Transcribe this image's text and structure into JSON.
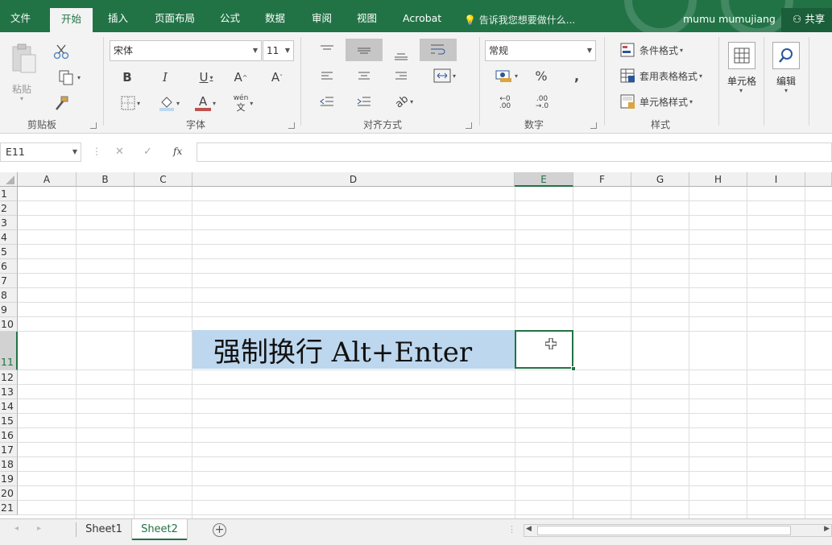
{
  "tabs": [
    "文件",
    "开始",
    "插入",
    "页面布局",
    "公式",
    "数据",
    "审阅",
    "视图",
    "Acrobat"
  ],
  "active_tab": "开始",
  "tell_me": "告诉我您想要做什么...",
  "user_name": "mumu mumujiang",
  "share": "共享",
  "clipboard": {
    "paste": "粘贴",
    "label": "剪贴板"
  },
  "font": {
    "name": "宋体",
    "size": "11",
    "label": "字体",
    "pinyin_top": "wén",
    "pinyin_bottom": "文"
  },
  "alignment": {
    "label": "对齐方式"
  },
  "number": {
    "format": "常规",
    "label": "数字",
    "percent": "%",
    "comma": ",",
    "dec_inc": "←0\n.00",
    "dec_dec": ".00\n→.0"
  },
  "styles": {
    "conditional": "条件格式",
    "table": "套用表格格式",
    "cell_styles": "单元格样式",
    "label": "样式"
  },
  "cells_group": {
    "label": "单元格"
  },
  "editing_group": {
    "label": "编辑"
  },
  "formula_bar": {
    "name_box": "E11",
    "fx": "fx",
    "cancel": "✕",
    "enter": "✓",
    "value": ""
  },
  "columns": [
    "A",
    "B",
    "C",
    "D",
    "E",
    "F",
    "G",
    "H",
    "I"
  ],
  "rows": [
    "1",
    "2",
    "3",
    "4",
    "5",
    "6",
    "7",
    "8",
    "9",
    "10",
    "11",
    "12",
    "13",
    "14",
    "15",
    "16",
    "17",
    "18",
    "19",
    "20",
    "21"
  ],
  "cell_D11": "强制换行 Alt+Enter",
  "sheets": [
    "Sheet1",
    "Sheet2"
  ],
  "active_sheet": "Sheet2",
  "colors": {
    "brand": "#217346",
    "highlight": "#bdd7ee"
  }
}
